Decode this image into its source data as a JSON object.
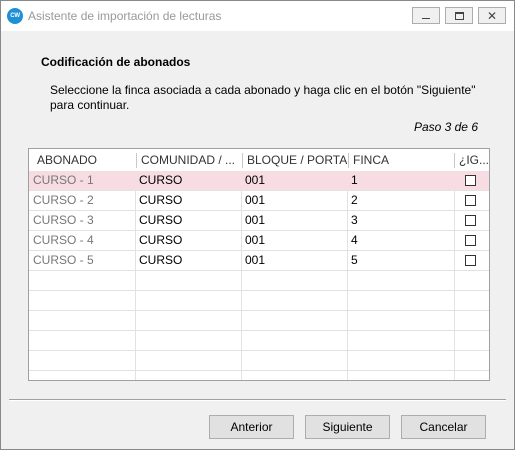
{
  "window": {
    "title": "Asistente de importación de lecturas",
    "app_icon_text": "CW"
  },
  "header": {
    "section_title": "Codificación de abonados",
    "instructions": "Seleccione la finca asociada a cada abonado y haga clic en el botón \"Siguiente\" para continuar.",
    "step": "Paso 3 de 6"
  },
  "grid": {
    "columns": [
      "ABONADO",
      "COMUNIDAD / ...",
      "BLOQUE / PORTAL",
      "FINCA",
      "¿IG..."
    ],
    "rows": [
      {
        "abonado": "CURSO - 1",
        "comunidad": "CURSO",
        "bloque": "001",
        "finca": "1",
        "ignorar": false
      },
      {
        "abonado": "CURSO - 2",
        "comunidad": "CURSO",
        "bloque": "001",
        "finca": "2",
        "ignorar": false
      },
      {
        "abonado": "CURSO - 3",
        "comunidad": "CURSO",
        "bloque": "001",
        "finca": "3",
        "ignorar": false
      },
      {
        "abonado": "CURSO - 4",
        "comunidad": "CURSO",
        "bloque": "001",
        "finca": "4",
        "ignorar": false
      },
      {
        "abonado": "CURSO - 5",
        "comunidad": "CURSO",
        "bloque": "001",
        "finca": "5",
        "ignorar": false
      }
    ],
    "selected_row": 0
  },
  "buttons": {
    "prev": "Anterior",
    "next": "Siguiente",
    "cancel": "Cancelar"
  },
  "icons": {
    "app": "app-logo-icon",
    "minimize": "minimize-icon",
    "maximize": "maximize-icon",
    "close": "close-icon"
  },
  "colors": {
    "selected_row": "#f7dde2",
    "app_icon": "#1e90d6"
  }
}
